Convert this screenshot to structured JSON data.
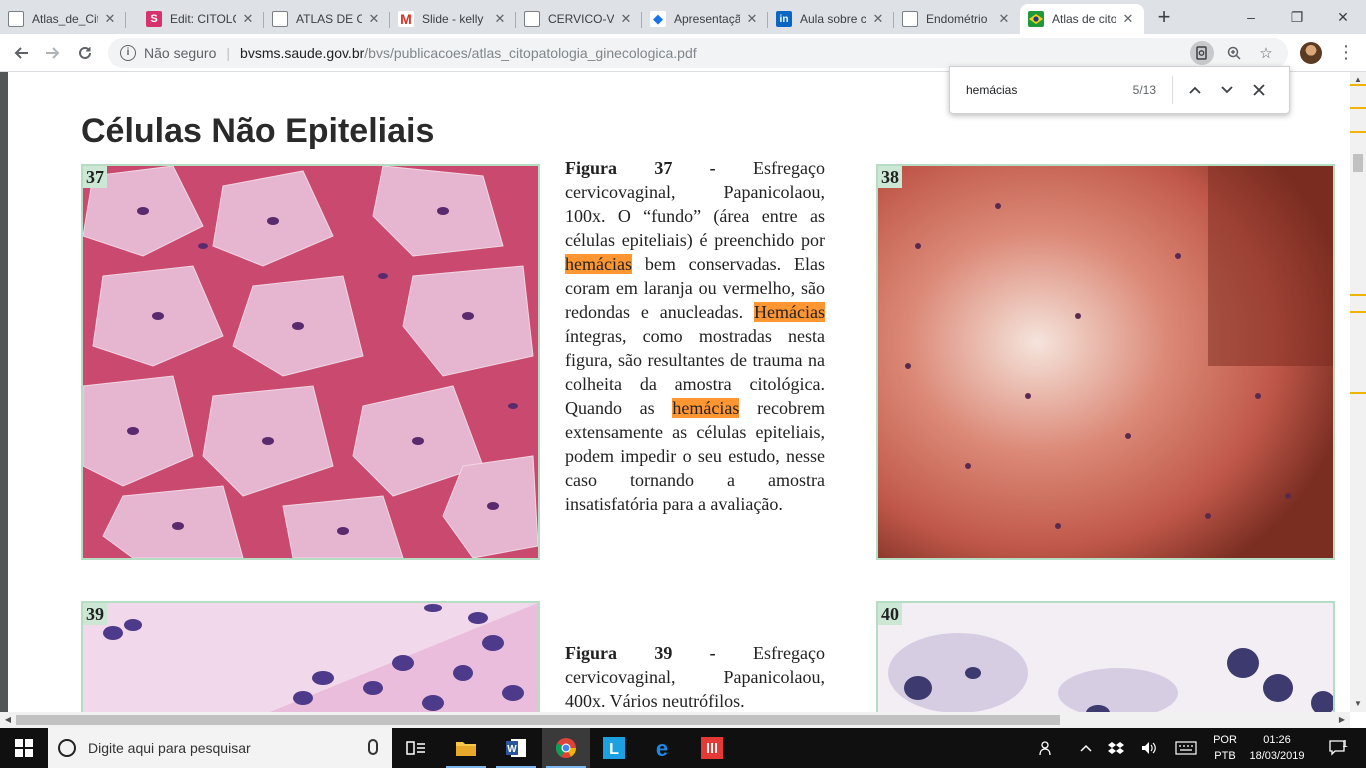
{
  "tabs": [
    {
      "title": "Atlas_de_Citopatologia",
      "favicon": "doc",
      "active": false
    },
    {
      "title": "Edit: CITOLOGIA",
      "favicon": "S",
      "color": "#d6336c",
      "active": false
    },
    {
      "title": "ATLAS DE CITOPATOLOGIA",
      "favicon": "doc",
      "active": false
    },
    {
      "title": "Slide - kelly",
      "favicon": "M",
      "color": "#d93025",
      "active": false
    },
    {
      "title": "CERVICO-VAGINAL",
      "favicon": "doc",
      "active": false
    },
    {
      "title": "Apresentação",
      "favicon": "edu",
      "color": "#1a73e8",
      "active": false
    },
    {
      "title": "Aula sobre citologia",
      "favicon": "in",
      "color": "#0a66c2",
      "active": false
    },
    {
      "title": "Endométrio",
      "favicon": "doc",
      "active": false
    },
    {
      "title": "Atlas de citopatologia",
      "favicon": "br",
      "active": true
    }
  ],
  "window_controls": {
    "minimize": "–",
    "maximize": "❐",
    "close": "✕"
  },
  "address": {
    "security": "Não seguro",
    "host": "bvsms.saude.gov.br",
    "path": "/bvs/publicacoes/atlas_citopatologia_ginecologica.pdf"
  },
  "find": {
    "query": "hemácias",
    "count": "5/13"
  },
  "page": {
    "heading": "Células Não Epiteliais",
    "fig37": {
      "number": "37",
      "caption_label": "Figura 37 -",
      "caption_pre": "Esfregaço cervicovaginal, Papanicolaou, 100x. O “fundo” (área entre as células epiteliais) é preenchido por",
      "caption_hit1": "hemácias",
      "caption_mid1": "bem conservadas. Elas coram em laranja ou vermelho, são redondas e anucleadas.",
      "caption_hit2": "Hemácias",
      "caption_mid2": "íntegras, como mostradas nesta figura, são resultantes de trauma na colheita da amostra citológica. Quando as",
      "caption_hit3": "hemácias",
      "caption_post": "recobrem extensamente as células epiteliais, podem impedir o seu estudo, nesse caso tornando a amostra insatisfatória para a avaliação."
    },
    "fig38": {
      "number": "38"
    },
    "fig39": {
      "number": "39",
      "caption_label": "Figura 39 -",
      "caption_text": "Esfregaço cervicovaginal, Papanicolaou, 400x. Vários neutrófilos."
    },
    "fig40": {
      "number": "40"
    }
  },
  "taskbar": {
    "search_placeholder": "Digite aqui para pesquisar",
    "lang_top": "POR",
    "lang_bottom": "PTB",
    "time": "01:26",
    "date": "18/03/2019",
    "notifications": "1"
  },
  "colors": {
    "find_highlight": "#ff9632",
    "scroll_marker": "#f0b400",
    "figure_border": "#b7dcc4",
    "figure_label_bg": "#cce8d5"
  }
}
